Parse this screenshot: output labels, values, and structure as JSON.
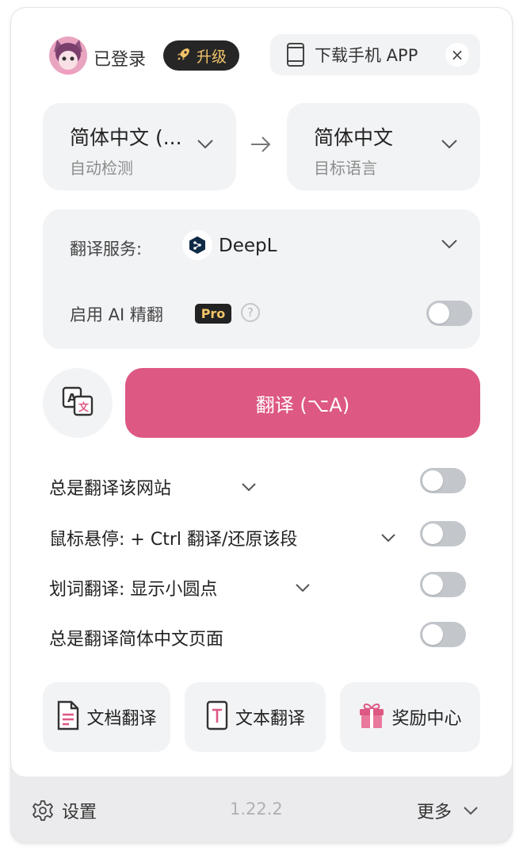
{
  "header": {
    "login_status": "已登录",
    "upgrade_label": "升级",
    "download_app_label": "下载手机 APP",
    "close_symbol": "×"
  },
  "languages": {
    "source": {
      "name": "简体中文 (...",
      "caption": "自动检测"
    },
    "target": {
      "name": "简体中文",
      "caption": "目标语言"
    }
  },
  "service": {
    "label": "翻译服务:",
    "name": "DeepL",
    "ai_label": "启用 AI 精翻",
    "pro_badge": "Pro",
    "help_symbol": "?",
    "ai_enabled": false
  },
  "actions": {
    "translate_label": "翻译 (⌥A)"
  },
  "options": [
    {
      "label": "总是翻译该网站",
      "has_dropdown": true,
      "enabled": false
    },
    {
      "label": "鼠标悬停:  + Ctrl 翻译/还原该段",
      "has_dropdown": true,
      "enabled": false
    },
    {
      "label": "划词翻译:  显示小圆点",
      "has_dropdown": true,
      "enabled": false
    },
    {
      "label": "总是翻译简体中文页面",
      "has_dropdown": false,
      "enabled": false
    }
  ],
  "tools": [
    {
      "label": "文档翻译",
      "icon": "document-icon"
    },
    {
      "label": "文本翻译",
      "icon": "text-icon"
    },
    {
      "label": "奖励中心",
      "icon": "gift-icon"
    }
  ],
  "footer": {
    "settings_label": "设置",
    "version": "1.22.2",
    "more_label": "更多"
  },
  "colors": {
    "accent": "#dd5883",
    "panel": "#f2f3f5",
    "toggle_off": "#c3c7cc",
    "badge_dark": "#262626",
    "badge_gold": "#f2c46a"
  }
}
